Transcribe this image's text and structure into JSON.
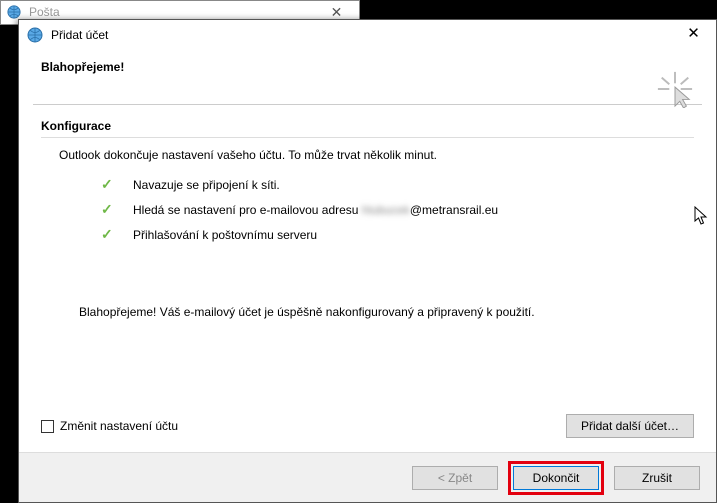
{
  "background": {
    "title": "Pošta"
  },
  "dialog": {
    "title": "Přidat účet",
    "header_title": "Blahopřejeme!",
    "section_title": "Konfigurace",
    "intro": "Outlook dokončuje nastavení vašeho účtu. To může trvat několik minut.",
    "steps": {
      "s1": "Navazuje se připojení k síti.",
      "s2_prefix": "Hledá se nastavení pro e-mailovou adresu ",
      "s2_blur": "hlubucek",
      "s2_suffix": "@metransrail.eu",
      "s3": "Přihlašování k poštovnímu serveru"
    },
    "congrats": "Blahopřejeme! Váš e-mailový účet je úspěšně nakonfigurovaný a připravený k použití.",
    "change_settings": "Změnit nastavení účtu",
    "buttons": {
      "add_another": "Přidat další účet…",
      "back": "< Zpět",
      "finish": "Dokončit",
      "cancel": "Zrušit"
    }
  }
}
